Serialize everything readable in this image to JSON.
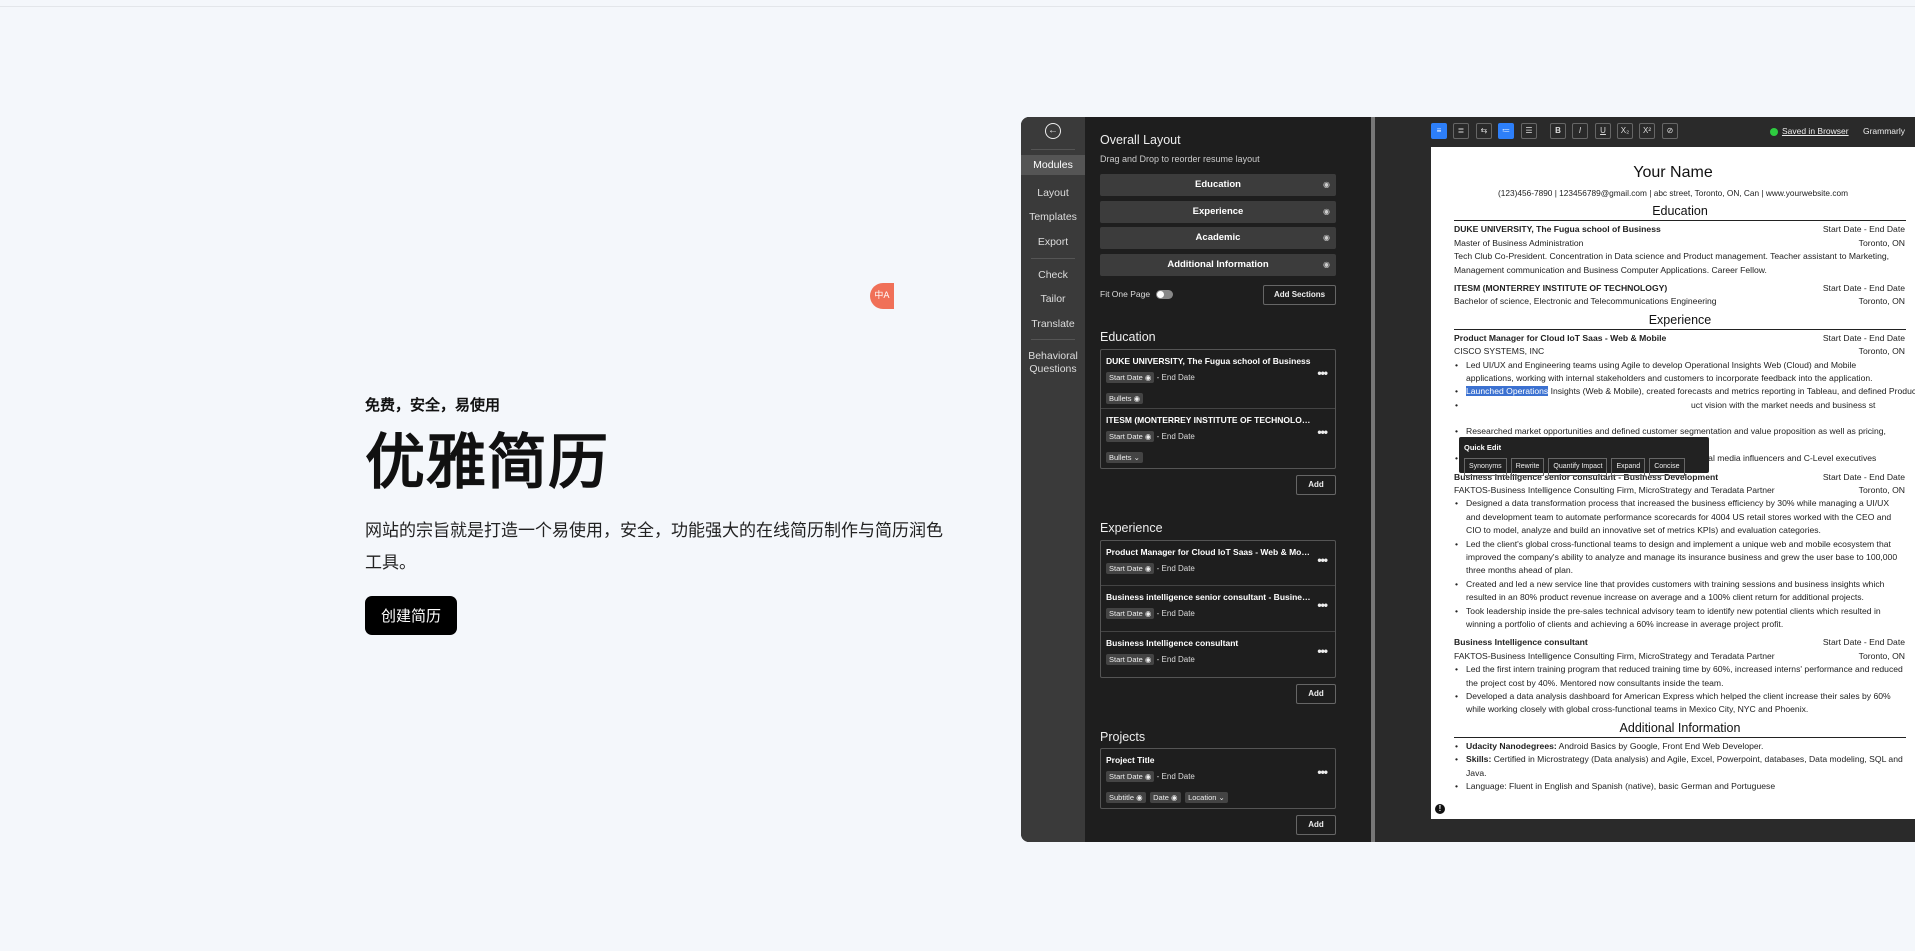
{
  "hero": {
    "eyebrow": "免费，安全，易使用",
    "title": "优雅简历",
    "description": "网站的宗旨就是打造一个易使用，安全，功能强大的在线简历制作与简历润色工具。",
    "cta_label": "创建简历"
  },
  "nav": {
    "items": [
      "Modules",
      "Layout",
      "Templates",
      "Export",
      "Check",
      "Tailor",
      "Translate",
      "Behavioral",
      "Questions"
    ],
    "active": "Modules"
  },
  "layout": {
    "title": "Overall Layout",
    "subtitle": "Drag and Drop to reorder resume layout",
    "sections": [
      "Education",
      "Experience",
      "Academic",
      "Additional Information"
    ],
    "fit_label": "Fit One Page",
    "add_sections_label": "Add Sections"
  },
  "edu_panel": {
    "title": "Education",
    "entries": [
      {
        "title": "DUKE UNIVERSITY, The Fugua school of Business",
        "start": "Start Date",
        "end": "- End Date",
        "pill": "Bullets"
      },
      {
        "title": "ITESM (MONTERREY INSTITUTE OF TECHNOLOGY)",
        "start": "Start Date",
        "end": "- End Date",
        "pill": "Bullets"
      }
    ],
    "add_label": "Add"
  },
  "exp_panel": {
    "title": "Experience",
    "entries": [
      {
        "title": "Product Manager for Cloud IoT Saas - Web & Mobile",
        "start": "Start Date",
        "end": "- End Date"
      },
      {
        "title": "Business intelligence senior consultant - Business D...",
        "start": "Start Date",
        "end": "- End Date"
      },
      {
        "title": "Business Intelligence consultant",
        "start": "Start Date",
        "end": "- End Date"
      }
    ],
    "add_label": "Add"
  },
  "proj_panel": {
    "title": "Projects",
    "entry": {
      "title": "Project Title",
      "start": "Start Date",
      "end": "- End Date",
      "pills": [
        "Subtitle",
        "Date",
        "Location"
      ]
    },
    "add_label": "Add"
  },
  "toolbar": {
    "buttons": [
      "≡",
      "≣",
      "⇆",
      "≔",
      "☰",
      "B",
      "I",
      "U",
      "X₂",
      "X²",
      "⊘"
    ],
    "saved_label": "Saved in Browser",
    "grammarly_label": "Grammarly"
  },
  "resume": {
    "name": "Your Name",
    "contact": "(123)456-7890 | 123456789@gmail.com | abc street, Toronto, ON, Can | www.yourwebsite.com",
    "education_heading": "Education",
    "duke_title": "DUKE UNIVERSITY, The Fugua school of Business",
    "duke_date": "Start Date - End Date",
    "duke_degree": "Master of Business Administration",
    "duke_loc": "Toronto, ON",
    "duke_desc": "Tech Club Co-President. Concentration in Data science and Product management. Teacher assistant to Marketing, Management communication and Business Computer Applications. Career Fellow.",
    "itesm_title": "ITESM (MONTERREY INSTITUTE OF TECHNOLOGY)",
    "itesm_date": "Start Date - End Date",
    "itesm_degree": "Bachelor of science, Electronic and Telecommunications Engineering",
    "itesm_loc": "Toronto, ON",
    "experience_heading": "Experience",
    "pm_title": "Product Manager for Cloud IoT Saas - Web & Mobile",
    "pm_date": "Start Date - End Date",
    "pm_company": "CISCO SYSTEMS, INC",
    "pm_loc": "Toronto, ON",
    "pm_b1": "Led UI/UX and Engineering teams using Agile to develop Operational Insights Web (Cloud) and Mobile applications, working with internal stakeholders and customers to incorporate feedback into the application.",
    "pm_b2_hl": "Launched Operations",
    "pm_b2": " Insights (Web & Mobile), created forecasts and metrics reporting in Tableau, and defined Product",
    "pm_b3": "uct vision with the market needs and business st",
    "pm_b4": "Researched market opportunities and defined customer segmentation and value proposition as well as pricing, licensing, and marketing sales content.",
    "pm_b5": "Evangelized products in road shows, Cisco live events with social media influencers and C-Level executives",
    "bi_title": "Business intelligence senior consultant - Business Development",
    "bi_date": "Start Date - End Date",
    "bi_company": "FAKTOS-Business Intelligence Consulting Firm, MicroStrategy and Teradata Partner",
    "bi_loc": "Toronto, ON",
    "bi_b1": "Designed a data transformation process that increased the business efficiency by 30% while managing a UI/UX and development team to automate performance scorecards for 4004 US retail stores worked with the CEO and CIO to model, analyze and build an innovative set of metrics KPIs) and evaluation categories.",
    "bi_b2": "Led the client's global cross-functional teams to design and implement a unique web and mobile ecosystem that improved the company's ability to analyze and manage its insurance business and grew the user base to 100,000 three months ahead of plan.",
    "bi_b3": "Created and led a new service line that provides customers with training sessions and business insights which resulted in an 80% product revenue increase on average and a 100% client return for additional projects.",
    "bi_b4": "Took leadership inside the pre-sales technical advisory team to identify new potential clients which resulted in winning a portfolio of clients and achieving a 60% increase in average project profit.",
    "bic_title": "Business Intelligence consultant",
    "bic_date": "Start Date - End Date",
    "bic_company": "FAKTOS-Business Intelligence Consulting Firm, MicroStrategy and Teradata Partner",
    "bic_loc": "Toronto, ON",
    "bic_b1": "Led the first intern training program that reduced training time by 60%, increased interns' performance and reduced the project cost by 40%. Mentored now consultants inside the team.",
    "bic_b2": "Developed a data analysis dashboard for American Express which helped the client increase their sales by 60% while working closely with global cross-functional teams in Mexico City, NYC and Phoenix.",
    "addl_heading": "Additional Information",
    "addl_b1_label": "Udacity Nanodegrees:",
    "addl_b1": " Android Basics by Google, Front End Web Developer.",
    "addl_b2_label": "Skills:",
    "addl_b2": " Certified in Microstrategy (Data analysis) and Agile, Excel, Powerpoint, databases, Data modeling, SQL and Java.",
    "addl_b3": "Language: Fluent in English and Spanish (native), basic German and Portuguese"
  },
  "quick_edit": {
    "title": "Quick Edit",
    "buttons": [
      "Synonyms",
      "Rewrite",
      "Quantify Impact",
      "Expand",
      "Concise"
    ]
  },
  "floating_avatar": "中A"
}
